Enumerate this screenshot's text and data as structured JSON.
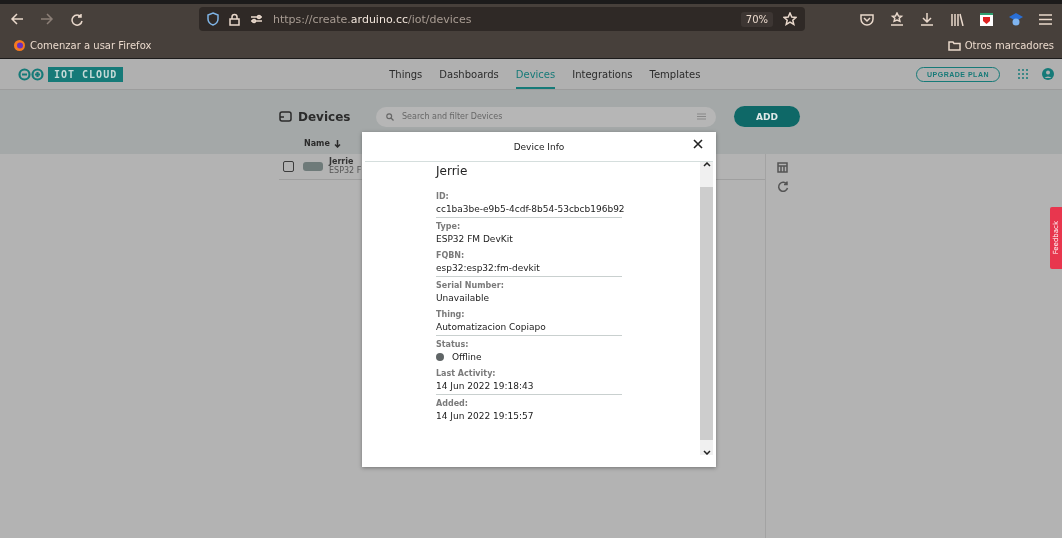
{
  "browser": {
    "url_host": "https://create.",
    "url_domain": "arduino.cc",
    "url_path": "/iot/devices",
    "zoom": "70%",
    "bookmarks": [
      {
        "label": "Comenzar a usar Firefox"
      }
    ],
    "other_bookmarks": "Otros marcadores"
  },
  "app": {
    "logo": "IOT CLOUD",
    "nav": [
      {
        "label": "Things",
        "selected": false
      },
      {
        "label": "Dashboards",
        "selected": false
      },
      {
        "label": "Devices",
        "selected": true
      },
      {
        "label": "Integrations",
        "selected": false
      },
      {
        "label": "Templates",
        "selected": false
      }
    ],
    "upgrade": "UPGRADE PLAN"
  },
  "devices": {
    "title": "Devices",
    "search": {
      "placeholder": "Search and filter Devices"
    },
    "add": "ADD",
    "column": "Name",
    "rows": [
      {
        "name": "Jerrie",
        "type": "ESP32 F",
        "checked": false
      }
    ]
  },
  "modal": {
    "title": "Device Info",
    "name": "Jerrie",
    "fields": [
      {
        "kind": "text",
        "label": "ID:",
        "value": "cc1ba3be-e9b5-4cdf-8b54-53cbcb196b92",
        "divider": true
      },
      {
        "kind": "text",
        "label": "Type:",
        "value": "ESP32 FM DevKit",
        "divider": false
      },
      {
        "kind": "text",
        "label": "FQBN:",
        "value": "esp32:esp32:fm-devkit",
        "divider": true
      },
      {
        "kind": "text",
        "label": "Serial Number:",
        "value": "Unavailable",
        "divider": false
      },
      {
        "kind": "text",
        "label": "Thing:",
        "value": "Automatizacion Copiapo",
        "divider": true
      },
      {
        "kind": "status",
        "label": "Status:",
        "value": "Offline",
        "color": "#5f6566",
        "divider": false
      },
      {
        "kind": "text",
        "label": "Last Activity:",
        "value": "14 Jun 2022 19:18:43",
        "divider": true
      },
      {
        "kind": "text",
        "label": "Added:",
        "value": "14 Jun 2022 19:15:57",
        "divider": false
      }
    ]
  },
  "feedback": "Feedback"
}
